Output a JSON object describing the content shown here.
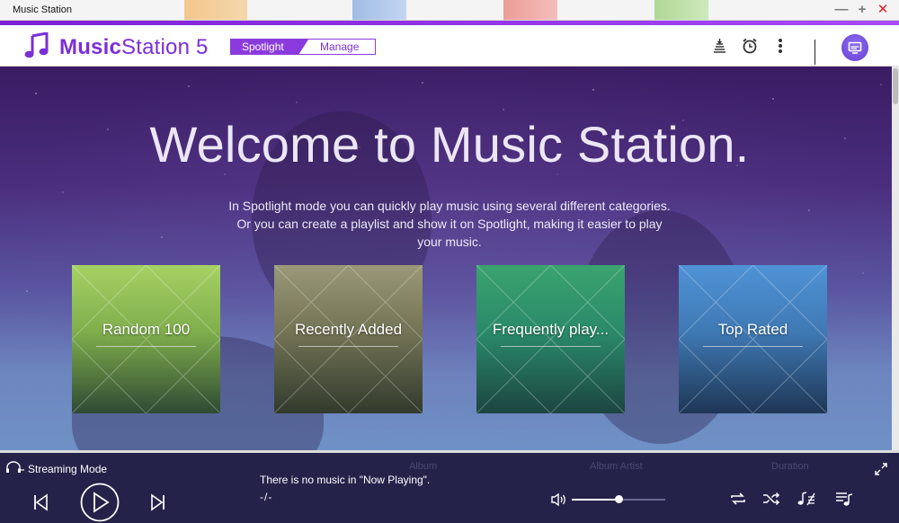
{
  "window": {
    "title": "Music Station",
    "controls": [
      "minimize",
      "maximize",
      "close"
    ]
  },
  "header": {
    "logo_bold": "Music",
    "logo_rest": "Station 5",
    "tabs": [
      {
        "label": "Spotlight",
        "active": true
      },
      {
        "label": "Manage",
        "active": false
      }
    ],
    "icons": [
      "queue-icon",
      "alarm-icon",
      "more-vertical-icon",
      "cast-icon"
    ]
  },
  "hero": {
    "title": "Welcome to Music Station.",
    "description": "In Spotlight mode you can quickly play music using several different categories. Or you can create a playlist and show it on Spotlight, making it easier to play your music.",
    "cards": [
      {
        "label": "Random 100"
      },
      {
        "label": "Recently Added"
      },
      {
        "label": "Frequently play..."
      },
      {
        "label": "Top Rated"
      }
    ]
  },
  "player": {
    "streaming_label": "Streaming Mode",
    "ghost_columns": [
      "Album",
      "Album Artist",
      "Duration"
    ],
    "now_playing": "There is no music in \"Now Playing\".",
    "time": "-/-",
    "volume": 0.5
  },
  "colors": {
    "accent": "#7b2fd6",
    "player_bg": "#25224a"
  }
}
